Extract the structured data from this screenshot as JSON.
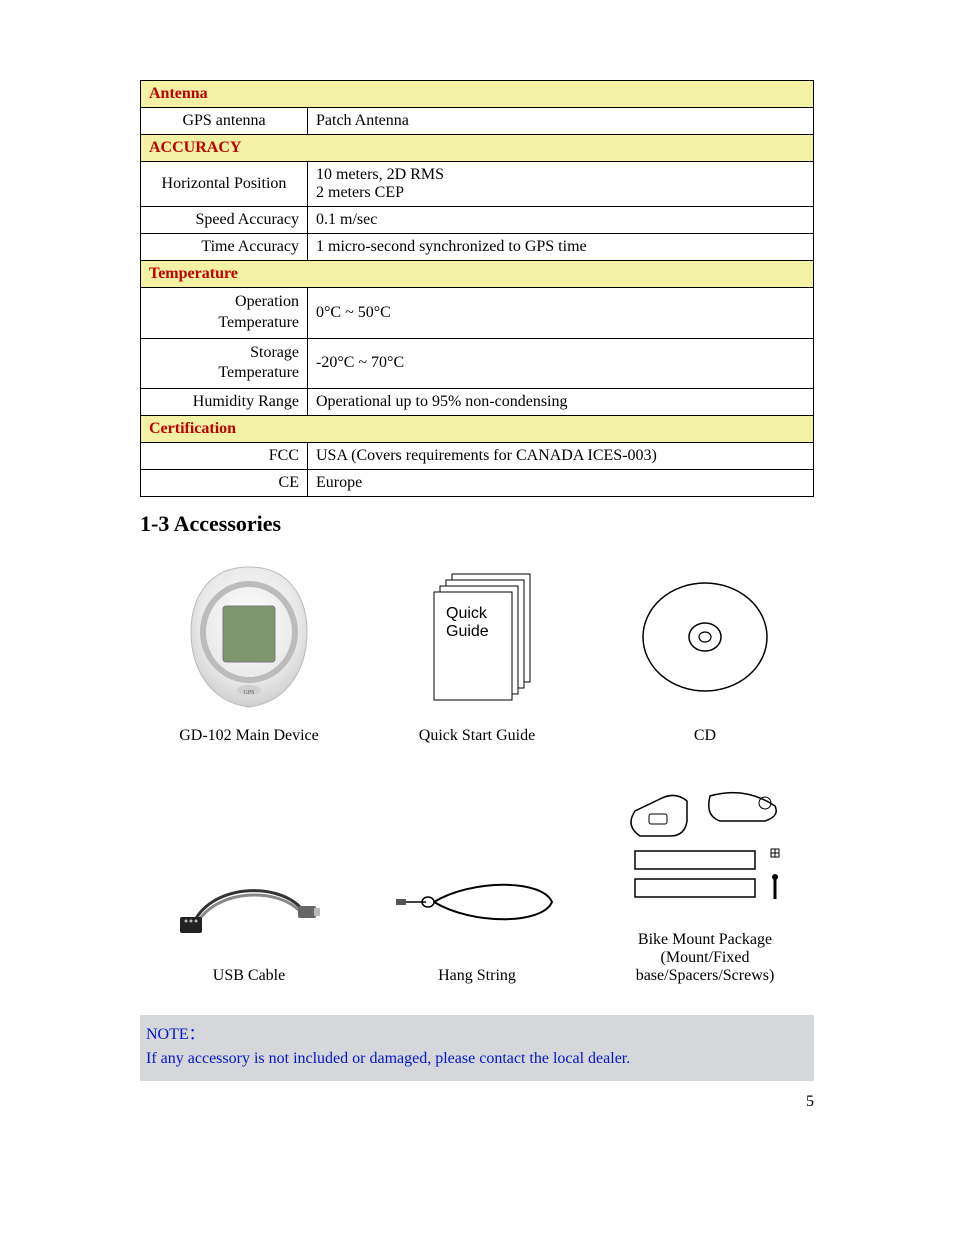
{
  "spec": {
    "s1": {
      "header": "Antenna",
      "rows": [
        {
          "label": "GPS antenna",
          "value": "Patch Antenna"
        }
      ]
    },
    "s2": {
      "header": "ACCURACY",
      "rows": [
        {
          "label": "Horizontal Position",
          "value_line1": "10 meters, 2D RMS",
          "value_line2": "2 meters CEP"
        },
        {
          "label": "Speed Accuracy",
          "value": "0.1 m/sec"
        },
        {
          "label": "Time Accuracy",
          "value": "1 micro-second synchronized to GPS time"
        }
      ]
    },
    "s3": {
      "header": "Temperature",
      "rows": [
        {
          "label_l1": "Operation",
          "label_l2": "Temperature",
          "value": "0°C ~ 50°C"
        },
        {
          "label_l1": "Storage",
          "label_l2": "Temperature",
          "value": "-20°C ~ 70°C"
        },
        {
          "label": "Humidity Range",
          "value": "Operational up to 95% non-condensing"
        }
      ]
    },
    "s4": {
      "header": "Certification",
      "rows": [
        {
          "label": "FCC",
          "value": "USA (Covers requirements for CANADA ICES-003)"
        },
        {
          "label": "CE",
          "value": "Europe"
        }
      ]
    }
  },
  "section_title": "1-3 Accessories",
  "accessories": {
    "a0": {
      "caption": "GD-102 Main Device"
    },
    "a1": {
      "caption": "Quick Start Guide",
      "booklet_l1": "Quick",
      "booklet_l2": "Guide"
    },
    "a2": {
      "caption": "CD"
    },
    "a3": {
      "caption": "USB Cable"
    },
    "a4": {
      "caption": "Hang String"
    },
    "a5": {
      "caption_l1": "Bike Mount Package",
      "caption_l2": "(Mount/Fixed base/Spacers/Screws)"
    }
  },
  "note": {
    "label": "NOTE：",
    "text": "If any accessory is not included or damaged, please contact the local dealer."
  },
  "page_number": "5"
}
